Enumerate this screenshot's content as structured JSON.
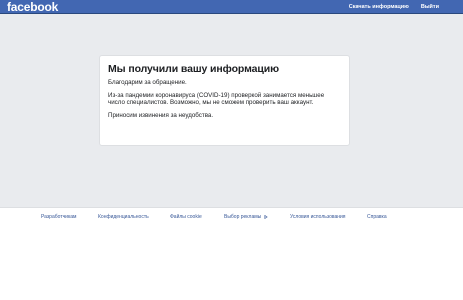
{
  "header": {
    "logo": "facebook",
    "actions": [
      {
        "label": "Скачать информацию"
      },
      {
        "label": "Выйти"
      }
    ]
  },
  "notice": {
    "title": "Мы получили вашу информацию",
    "thanks": "Благодарим за обращение.",
    "body": "Из-за пандемии коронавируса (COVID-19) проверкой занимается меньшее число специалистов. Возможно, мы не сможем проверить ваш аккаунт.",
    "apology": "Приносим извинения за неудобства."
  },
  "footer": {
    "links": [
      {
        "label": "Разработчикам"
      },
      {
        "label": "Конфиденциальность"
      },
      {
        "label": "Файлы cookie"
      },
      {
        "label": "Выбор рекламы",
        "icon": "adchoices-icon"
      },
      {
        "label": "Условия использования"
      },
      {
        "label": "Справка"
      }
    ]
  },
  "colors": {
    "brand_blue": "#4267b2",
    "page_background": "#e9ebee",
    "link_blue": "#385898",
    "text": "#1c1e21",
    "card_border": "#dddfe2"
  }
}
